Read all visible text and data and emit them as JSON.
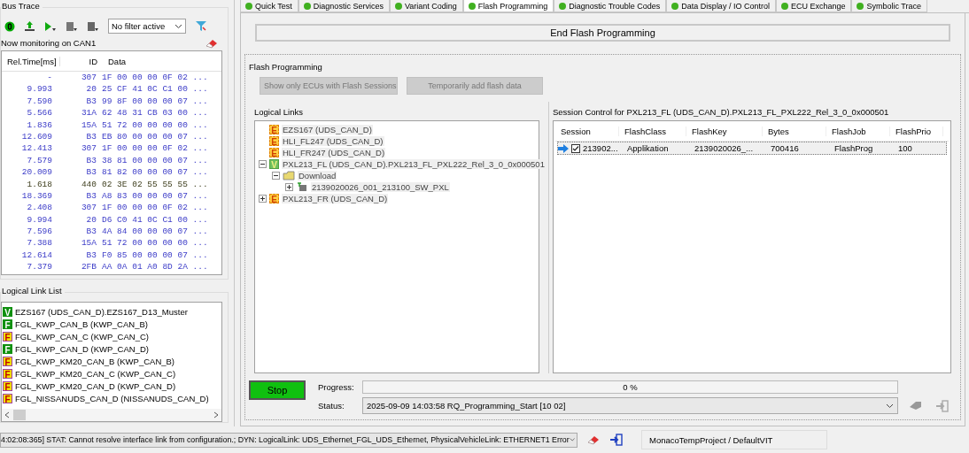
{
  "bus_trace": {
    "title": "Bus Trace",
    "filter": "No filter active",
    "monitoring": "Now monitoring on CAN1",
    "columns": [
      "Rel.Time[ms]",
      "ID",
      "Data"
    ],
    "rows": [
      {
        "time": "-",
        "id": "307",
        "data": "1F 00 00 00 0F 02 ...",
        "kind": "rx"
      },
      {
        "time": "9.993",
        "id": "20",
        "data": "25 CF 41 0C C1 00 ...",
        "kind": "rx"
      },
      {
        "time": "7.590",
        "id": "B3",
        "data": "99 8F 00 00 00 07 ...",
        "kind": "rx"
      },
      {
        "time": "5.566",
        "id": "31A",
        "data": "62 48 31 CB 03 00 ...",
        "kind": "rx"
      },
      {
        "time": "1.836",
        "id": "15A",
        "data": "51 72 00 00 00 00 ...",
        "kind": "rx"
      },
      {
        "time": "12.609",
        "id": "B3",
        "data": "EB 80 00 00 00 07 ...",
        "kind": "rx"
      },
      {
        "time": "12.413",
        "id": "307",
        "data": "1F 00 00 00 0F 02 ...",
        "kind": "rx"
      },
      {
        "time": "7.579",
        "id": "B3",
        "data": "38 81 00 00 00 07 ...",
        "kind": "rx"
      },
      {
        "time": "20.009",
        "id": "B3",
        "data": "81 82 00 00 00 07 ...",
        "kind": "rx"
      },
      {
        "time": "1.618",
        "id": "440",
        "data": "02 3E 02 55 55 55 ...",
        "kind": "tx"
      },
      {
        "time": "18.369",
        "id": "B3",
        "data": "A8 83 00 00 00 07 ...",
        "kind": "rx"
      },
      {
        "time": "2.408",
        "id": "307",
        "data": "1F 00 00 00 0F 02 ...",
        "kind": "rx"
      },
      {
        "time": "9.994",
        "id": "20",
        "data": "D6 C0 41 0C C1 00 ...",
        "kind": "rx"
      },
      {
        "time": "7.596",
        "id": "B3",
        "data": "4A 84 00 00 00 07 ...",
        "kind": "rx"
      },
      {
        "time": "7.388",
        "id": "15A",
        "data": "51 72 00 00 00 00 ...",
        "kind": "rx"
      },
      {
        "time": "12.614",
        "id": "B3",
        "data": "F0 85 00 00 00 07 ...",
        "kind": "rx"
      },
      {
        "time": "7.379",
        "id": "2FB",
        "data": "AA 0A 01 A0 8D 2A ...",
        "kind": "rx"
      }
    ]
  },
  "logical_link_list": {
    "title": "Logical Link List",
    "items": [
      {
        "badge": "V",
        "label": "EZS167 (UDS_CAN_D).EZS167_D13_Muster",
        "color": "#109010"
      },
      {
        "badge": "F",
        "label": "FGL_KWP_CAN_B (KWP_CAN_B)",
        "color": "#109010"
      },
      {
        "badge": "F",
        "label": "FGL_KWP_CAN_C (KWP_CAN_C)",
        "color": "#f0e000"
      },
      {
        "badge": "F",
        "label": "FGL_KWP_CAN_D (KWP_CAN_D)",
        "color": "#109010"
      },
      {
        "badge": "F",
        "label": "FGL_KWP_KM20_CAN_B (KWP_CAN_B)",
        "color": "#f0e000"
      },
      {
        "badge": "F",
        "label": "FGL_KWP_KM20_CAN_C (KWP_CAN_C)",
        "color": "#f0e000"
      },
      {
        "badge": "F",
        "label": "FGL_KWP_KM20_CAN_D (KWP_CAN_D)",
        "color": "#f0e000"
      },
      {
        "badge": "F",
        "label": "FGL_NISSANUDS_CAN_D (NISSANUDS_CAN_D)",
        "color": "#f0e000"
      }
    ]
  },
  "tabs": [
    {
      "label": "Quick Test",
      "selected": false
    },
    {
      "label": "Diagnostic Services",
      "selected": false
    },
    {
      "label": "Variant Coding",
      "selected": false
    },
    {
      "label": "Flash Programming",
      "selected": true
    },
    {
      "label": "Diagnostic Trouble Codes",
      "selected": false
    },
    {
      "label": "Data Display / IO Control",
      "selected": false
    },
    {
      "label": "ECU Exchange",
      "selected": false
    },
    {
      "label": "Symbolic Trace",
      "selected": false
    }
  ],
  "end_button": "End Flash Programming",
  "flash_programming": {
    "title": "Flash Programming",
    "buttons": [
      {
        "label": "Show only ECUs with Flash Sessions",
        "disabled": true
      },
      {
        "label": "Temporarily add flash data",
        "disabled": true
      }
    ],
    "logical_links": {
      "title": "Logical Links",
      "tree": [
        {
          "badge": "E",
          "label": "EZS167 (UDS_CAN_D)",
          "kind": "ecu"
        },
        {
          "badge": "E",
          "label": "HLI_FL247 (UDS_CAN_D)",
          "kind": "ecu"
        },
        {
          "badge": "E",
          "label": "HLI_FR247 (UDS_CAN_D)",
          "kind": "ecu"
        },
        {
          "badge": "V",
          "label": "PXL213_FL (UDS_CAN_D).PXL213_FL_PXL222_Rel_3_0_0x000501",
          "kind": "variant",
          "expanded": true,
          "children": [
            {
              "label": "Download",
              "kind": "folder",
              "expanded": true,
              "children": [
                {
                  "label": "2139020026_001_213100_SW_PXL",
                  "kind": "session",
                  "expanded": false
                }
              ]
            }
          ]
        },
        {
          "badge": "E",
          "label": "PXL213_FR (UDS_CAN_D)",
          "kind": "ecu",
          "expanded": false
        }
      ]
    },
    "session_control": {
      "title": "Session Control for PXL213_FL (UDS_CAN_D).PXL213_FL_PXL222_Rel_3_0_0x000501",
      "columns": [
        "Session",
        "FlashClass",
        "FlashKey",
        "Bytes",
        "FlashJob",
        "FlashPrio"
      ],
      "rows": [
        {
          "checked": true,
          "cells": [
            "213902...",
            "Applikation",
            "2139020026_...",
            "700416",
            "FlashProg",
            "100"
          ]
        }
      ]
    },
    "stop_button": "Stop",
    "progress_label": "Progress:",
    "progress": {
      "level": 0,
      "text": "0 %"
    },
    "status_label": "Status:",
    "status": "2025-09-09 14:03:58  RQ_Programming_Start [10 02]"
  },
  "status_bar": {
    "message": "4:02:08:365] STAT: Cannot resolve interface link from configuration.; DYN: LogicalLink: UDS_Ethernet_FGL_UDS_Ethernet, PhysicalVehicleLink: ETHERNET1 Error",
    "project": "MonacoTempProject / DefaultVIT"
  }
}
